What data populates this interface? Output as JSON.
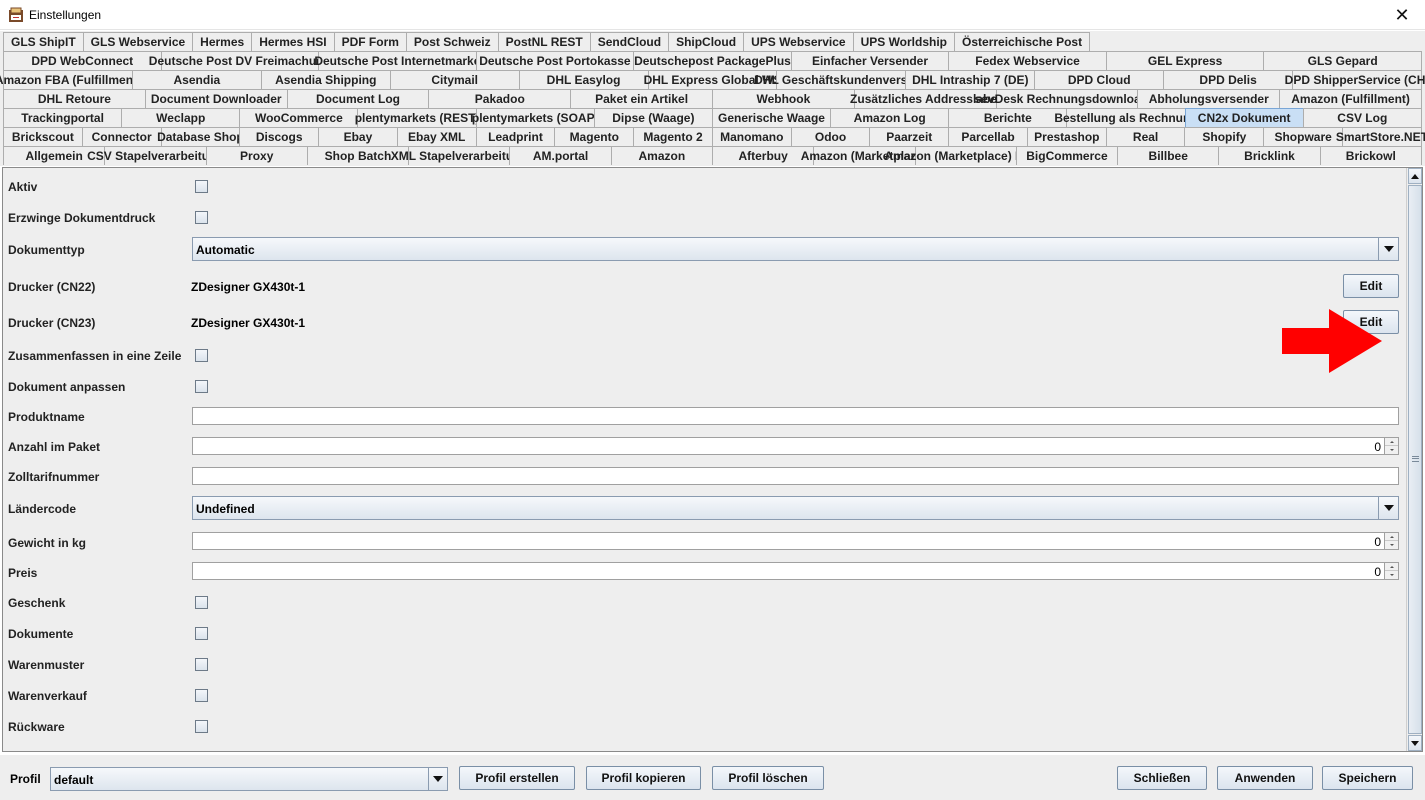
{
  "window": {
    "title": "Einstellungen",
    "close_glyph": "✕"
  },
  "tabs": {
    "rows": [
      [
        "GLS ShipIT",
        "GLS Webservice",
        "Hermes",
        "Hermes HSI",
        "PDF Form",
        "Post Schweiz",
        "PostNL REST",
        "SendCloud",
        "ShipCloud",
        "UPS Webservice",
        "UPS Worldship",
        "Österreichische Post"
      ],
      [
        "DPD WebConnect",
        "Deutsche Post DV Freimachung",
        "Deutsche Post Internetmarke",
        "Deutsche Post Portokasse",
        "Deutschepost PackagePlus",
        "Einfacher Versender",
        "Fedex Webservice",
        "GEL Express",
        "GLS Gepard"
      ],
      [
        "Amazon FBA (Fulfillment)",
        "Asendia",
        "Asendia Shipping",
        "Citymail",
        "DHL Easylog",
        "DHL Express Global WS",
        "DHL Geschäftskundenversand",
        "DHL Intraship 7 (DE)",
        "DPD Cloud",
        "DPD Delis",
        "DPD ShipperService (CH)"
      ],
      [
        "DHL Retoure",
        "Document Downloader",
        "Document Log",
        "Pakadoo",
        "Paket ein Artikel",
        "Webhook",
        "Zusätzliches Addresslabel",
        "sevDesk Rechnungsdownloader",
        "Abholungsversender",
        "Amazon (Fulfillment)"
      ],
      [
        "Trackingportal",
        "Weclapp",
        "WooCommerce",
        "plentymarkets (REST)",
        "plentymarkets (SOAP)",
        "Dipse (Waage)",
        "Generische Waage",
        "Amazon Log",
        "Berichte",
        "Bestellung als Rechnung",
        "CN2x Dokument",
        "CSV Log"
      ],
      [
        "Brickscout",
        "Connector",
        "Database Shop",
        "Discogs",
        "Ebay",
        "Ebay XML",
        "Leadprint",
        "Magento",
        "Magento 2",
        "Manomano",
        "Odoo",
        "Paarzeit",
        "Parcellab",
        "Prestashop",
        "Real",
        "Shopify",
        "Shopware",
        "SmartStore.NET"
      ],
      [
        "Allgemein",
        "CSV Stapelverarbeitung",
        "Proxy",
        "Shop Batch",
        "XML Stapelverarbeitung",
        "AM.portal",
        "Amazon",
        "Afterbuy",
        "Amazon (Marketplace)",
        "Amazon (Marketplace) REST",
        "BigCommerce",
        "Billbee",
        "Bricklink",
        "Brickowl"
      ]
    ],
    "selected": "CN2x Dokument"
  },
  "form": {
    "aktiv": "Aktiv",
    "erzwinge": "Erzwinge Dokumentdruck",
    "dokumenttyp_label": "Dokumenttyp",
    "dokumenttyp_value": "Automatic",
    "drucker_cn22_label": "Drucker (CN22)",
    "drucker_cn22_value": "ZDesigner GX430t-1",
    "drucker_cn23_label": "Drucker (CN23)",
    "drucker_cn23_value": "ZDesigner GX430t-1",
    "edit_label": "Edit",
    "zusammenfassen": "Zusammenfassen in eine Zeile",
    "dokument_anpassen": "Dokument anpassen",
    "produktname_label": "Produktname",
    "produktname_value": "",
    "anzahl_label": "Anzahl im Paket",
    "anzahl_value": "0",
    "zolltarif_label": "Zolltarifnummer",
    "zolltarif_value": "",
    "laendercode_label": "Ländercode",
    "laendercode_value": "Undefined",
    "gewicht_label": "Gewicht in kg",
    "gewicht_value": "0",
    "preis_label": "Preis",
    "preis_value": "0",
    "geschenk": "Geschenk",
    "dokumente": "Dokumente",
    "warenmuster": "Warenmuster",
    "warenverkauf": "Warenverkauf",
    "rueckware": "Rückware"
  },
  "bottom": {
    "profil_label": "Profil",
    "profil_value": "default",
    "profil_erstellen": "Profil erstellen",
    "profil_kopieren": "Profil kopieren",
    "profil_loeschen": "Profil löschen",
    "schliessen": "Schließen",
    "anwenden": "Anwenden",
    "speichern": "Speichern"
  },
  "colors": {
    "arrow": "#ff0000",
    "selected_tab": "#c9dff5"
  },
  "icons": {
    "app": "app-icon",
    "close": "close-icon",
    "dropdown": "chevron-down-icon",
    "annotation": "red-arrow-icon"
  }
}
